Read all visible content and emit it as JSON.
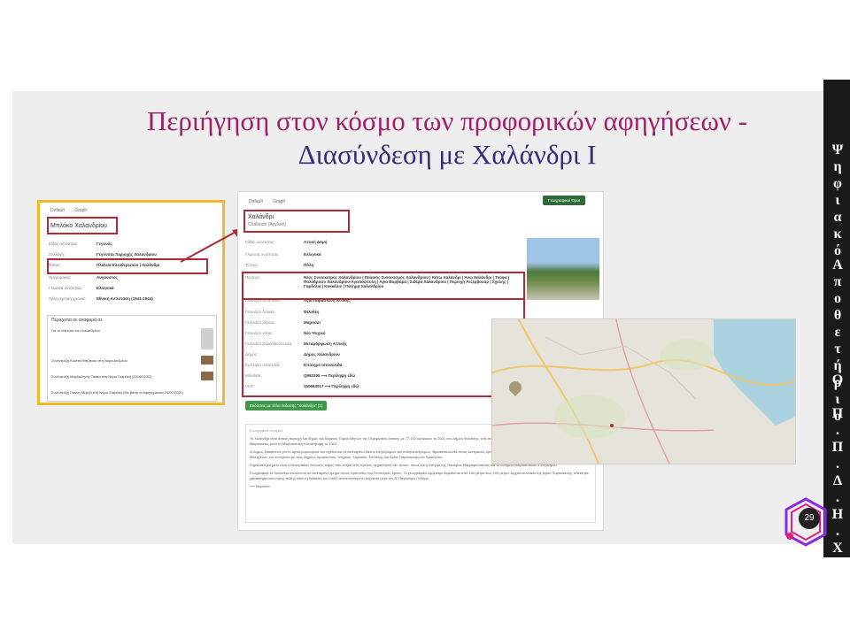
{
  "title": {
    "line1": "Περιήγηση στον κόσμο των προφορικών αφηγήσεων  -",
    "line2": "Διασύνδεση με Χαλάνδρι Ι"
  },
  "sidebar": {
    "words": [
      "Ψηφιακό",
      "Αποθετήριο",
      "Ο.Π.Π.Δ.Η.Χ."
    ]
  },
  "page_number": "29",
  "shot1": {
    "tabs": [
      "Default",
      "Graph"
    ],
    "title": "Μπλόκο Χαλανδρίου",
    "rows": [
      {
        "label": "Είδος οντότητας:",
        "value": "Γεγονός"
      },
      {
        "label": "Συλλογή:",
        "value": "Γεγονότα περιοχής Χαλανδρίου"
      },
      {
        "label": "Τόπος:",
        "value": "Πλατεία Ελευθερωτών | Χαλάνδρι"
      },
      {
        "label": "Ημερομηνία:",
        "value": "Αύγουστος"
      },
      {
        "label": "Γλώσσα οντότητας:",
        "value": "Ελληνικά"
      },
      {
        "label": "Άλλη σχετική χρονιά:",
        "value": "Εθνική Αντίσταση (1941-1944)"
      }
    ],
    "section_title": "Περιέχεται σε αναφορά σε",
    "items": [
      "Για το Μπλόκο του Χαλανδρίου",
      "Συνέντευξη Κώστα Μπιζάνου στη Νόρα Ανδρέου",
      "Συνέντευξη Μαγδαληνής Τσάκα στη Νόρα Σταμάκη [2018/02/02]",
      "Συνέντευξη Γιάννη Μεριζά στη Νόρα Σταμάκη (Με βάση το Αφηγηματικό 24/07/2021)"
    ]
  },
  "shot2": {
    "tabs": [
      "Default",
      "Graph"
    ],
    "button": "Γεωγραφικοί Όροι",
    "title": "Χαλάνδρι",
    "subtitle": "Chalandri (Αγγλική)",
    "rows": [
      {
        "label": "Είδος οντότητας:",
        "value": "Αττική Δομή"
      },
      {
        "label": "Γλώσσα οντότητας:",
        "value": "Ελληνικά"
      },
      {
        "label": "Τύπος:",
        "value": "Πόλη"
      },
      {
        "label": "Περιέχει:",
        "value": "Νέος Συνοικισμός Χαλανδρίου | Παλαιός Συνοικισμός Χαλανδρίου | Κάτω Χαλάνδρι | Άνω Χαλάνδρι | Τούφα | Πολύδροσο Χαλανδρίου-Αγαπούπολη | Αγία Βαρβάρα | Σιδέρα Χαλανδρίου | Περιοχή Ρεζέρβουαρ | Σχολής | Γαρδέλια | Κοκκάλιο | Πάτημα Χαλανδρίου"
      },
      {
        "label": "Γειτνιάζει ανατολικά:",
        "value": "Αγία Παρασκευή Αττικής"
      },
      {
        "label": "Γειτνιάζει δυτικά:",
        "value": "Φιλοθέη"
      },
      {
        "label": "Γειτνιάζει βόρεια:",
        "value": "Μαρούσι"
      },
      {
        "label": "Γειτνιάζει νότια:",
        "value": "Νέο Ψυχικό"
      },
      {
        "label": "Γειτνιάζει βορειοανατολικά:",
        "value": "Μεταμόρφωση Αττικής"
      },
      {
        "label": "Δήμος:",
        "value": "Δήμος Χαλανδρίου"
      },
      {
        "label": "Εμπειρία οντότητας:",
        "value": "Επίσημο υποσελίδα"
      },
      {
        "label": "Wikidata:",
        "value": "Q992265 ⟶ Περίληψη εδώ"
      },
      {
        "label": "VIAF:",
        "value": "150684017 ⟶ Περίληψη εδώ"
      }
    ],
    "green_button": "Εκδόσεις με τίτλο έκδοσης \"Χαλάνδρι\" (1)",
    "text_header": "Γεωγραφικά στοιχεία",
    "paragraphs": [
      "Το Χαλάνδρι είναι αστική περιοχή και δήμος του Βορείου Τομέα Αθηνών της Περιφέρειας Αττικής με 77.102 κατοίκους το 2021 στο Δήμου Φιλοθέης, τότε ανήκε στην Επαρχία του Δήμου Αθηναίων, Καταστάθηκε από Μικρασιάτες μετά τη Μικρασιατική Καταστροφή το 1922.",
      "Ο Δήμος διακρίνεται για το άρτιο ρυμοτομικό του σχέδιο και το εκτεταμένο δίκτυο πεζοδρόμων και ποδηλατοδρόμων. Βρίσκεται κοντά στους κεντρικούς δρόμους της Αττικής, όπως η Αττική Οδός, η Κηφισίας και η Μεσογείων, και συνορεύει με τους Δήμους Αμαρουσίου, Ψυχικού, Κηφισιάς, Πεντέλης και Αγίας Παρασκευής και Ηρακλείου.",
      "Σημαντικό μνημείο είναι ο Μυκηναϊκός θολωτός τάφος που ανήκει στις πρώτες αρχαιότητες του τόπου, όπως και η σπηλιά της Παναγίας Μαρμαριώτισσας και το Μνημείο Μικρασιατικού Ελληνισμού.",
      "Γεωγραφικά το Χαλάνδρι απλώνεται σε εκτεταμένο τμήμα στους πρόποδες του Πεντελικού όρους. Το γεωγραφικό υψόμετρο κυμαίνεται από 160 μέτρα έως 200 μέτρα. Αρχικά συνοικία της Αγίας Παρασκευής, απέκτησε χαρακτήρα αυτόνομης πόλης κατά τη δεκαετία του 1960, αναπτυσσόμενο ταχύτατα μετά τον Β' Παγκόσμιο Πόλεμο.",
      "⟶ Μαρούσι"
    ]
  }
}
